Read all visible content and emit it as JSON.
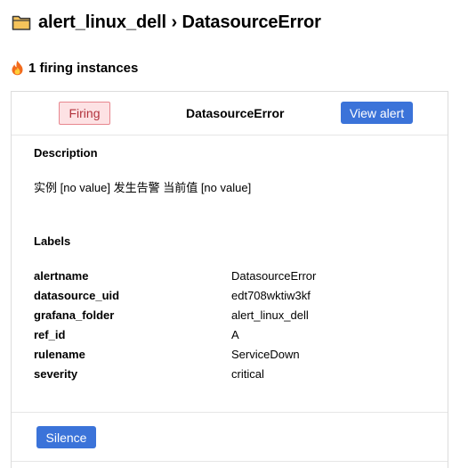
{
  "header": {
    "folder_icon": "folder-icon",
    "title": "alert_linux_dell › DatasourceError"
  },
  "summary": {
    "fire_icon": "fire-icon",
    "firing_count_text": "1 firing instances"
  },
  "alert_card": {
    "status_badge": "Firing",
    "alert_name": "DatasourceError",
    "view_alert_label": "View alert",
    "description_heading": "Description",
    "description_text": "实例 [no value] 发生告警 当前值 [no value]",
    "labels_heading": "Labels",
    "labels": [
      {
        "key": "alertname",
        "value": "DatasourceError"
      },
      {
        "key": "datasource_uid",
        "value": "edt708wktiw3kf"
      },
      {
        "key": "grafana_folder",
        "value": "alert_linux_dell"
      },
      {
        "key": "ref_id",
        "value": "A"
      },
      {
        "key": "rulename",
        "value": "ServiceDown"
      },
      {
        "key": "severity",
        "value": "critical"
      }
    ],
    "silence_label": "Silence"
  },
  "colors": {
    "primary_button": "#3b73d9",
    "firing_badge_bg": "#fde2e4",
    "firing_badge_border": "#e7878f",
    "firing_badge_text": "#b2323c"
  }
}
